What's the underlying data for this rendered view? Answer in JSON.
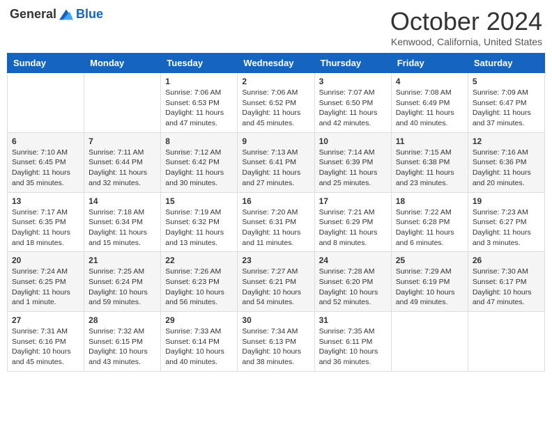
{
  "header": {
    "logo_general": "General",
    "logo_blue": "Blue",
    "month_title": "October 2024",
    "location": "Kenwood, California, United States"
  },
  "days_of_week": [
    "Sunday",
    "Monday",
    "Tuesday",
    "Wednesday",
    "Thursday",
    "Friday",
    "Saturday"
  ],
  "weeks": [
    [
      {
        "day": "",
        "info": ""
      },
      {
        "day": "",
        "info": ""
      },
      {
        "day": "1",
        "info": "Sunrise: 7:06 AM\nSunset: 6:53 PM\nDaylight: 11 hours and 47 minutes."
      },
      {
        "day": "2",
        "info": "Sunrise: 7:06 AM\nSunset: 6:52 PM\nDaylight: 11 hours and 45 minutes."
      },
      {
        "day": "3",
        "info": "Sunrise: 7:07 AM\nSunset: 6:50 PM\nDaylight: 11 hours and 42 minutes."
      },
      {
        "day": "4",
        "info": "Sunrise: 7:08 AM\nSunset: 6:49 PM\nDaylight: 11 hours and 40 minutes."
      },
      {
        "day": "5",
        "info": "Sunrise: 7:09 AM\nSunset: 6:47 PM\nDaylight: 11 hours and 37 minutes."
      }
    ],
    [
      {
        "day": "6",
        "info": "Sunrise: 7:10 AM\nSunset: 6:45 PM\nDaylight: 11 hours and 35 minutes."
      },
      {
        "day": "7",
        "info": "Sunrise: 7:11 AM\nSunset: 6:44 PM\nDaylight: 11 hours and 32 minutes."
      },
      {
        "day": "8",
        "info": "Sunrise: 7:12 AM\nSunset: 6:42 PM\nDaylight: 11 hours and 30 minutes."
      },
      {
        "day": "9",
        "info": "Sunrise: 7:13 AM\nSunset: 6:41 PM\nDaylight: 11 hours and 27 minutes."
      },
      {
        "day": "10",
        "info": "Sunrise: 7:14 AM\nSunset: 6:39 PM\nDaylight: 11 hours and 25 minutes."
      },
      {
        "day": "11",
        "info": "Sunrise: 7:15 AM\nSunset: 6:38 PM\nDaylight: 11 hours and 23 minutes."
      },
      {
        "day": "12",
        "info": "Sunrise: 7:16 AM\nSunset: 6:36 PM\nDaylight: 11 hours and 20 minutes."
      }
    ],
    [
      {
        "day": "13",
        "info": "Sunrise: 7:17 AM\nSunset: 6:35 PM\nDaylight: 11 hours and 18 minutes."
      },
      {
        "day": "14",
        "info": "Sunrise: 7:18 AM\nSunset: 6:34 PM\nDaylight: 11 hours and 15 minutes."
      },
      {
        "day": "15",
        "info": "Sunrise: 7:19 AM\nSunset: 6:32 PM\nDaylight: 11 hours and 13 minutes."
      },
      {
        "day": "16",
        "info": "Sunrise: 7:20 AM\nSunset: 6:31 PM\nDaylight: 11 hours and 11 minutes."
      },
      {
        "day": "17",
        "info": "Sunrise: 7:21 AM\nSunset: 6:29 PM\nDaylight: 11 hours and 8 minutes."
      },
      {
        "day": "18",
        "info": "Sunrise: 7:22 AM\nSunset: 6:28 PM\nDaylight: 11 hours and 6 minutes."
      },
      {
        "day": "19",
        "info": "Sunrise: 7:23 AM\nSunset: 6:27 PM\nDaylight: 11 hours and 3 minutes."
      }
    ],
    [
      {
        "day": "20",
        "info": "Sunrise: 7:24 AM\nSunset: 6:25 PM\nDaylight: 11 hours and 1 minute."
      },
      {
        "day": "21",
        "info": "Sunrise: 7:25 AM\nSunset: 6:24 PM\nDaylight: 10 hours and 59 minutes."
      },
      {
        "day": "22",
        "info": "Sunrise: 7:26 AM\nSunset: 6:23 PM\nDaylight: 10 hours and 56 minutes."
      },
      {
        "day": "23",
        "info": "Sunrise: 7:27 AM\nSunset: 6:21 PM\nDaylight: 10 hours and 54 minutes."
      },
      {
        "day": "24",
        "info": "Sunrise: 7:28 AM\nSunset: 6:20 PM\nDaylight: 10 hours and 52 minutes."
      },
      {
        "day": "25",
        "info": "Sunrise: 7:29 AM\nSunset: 6:19 PM\nDaylight: 10 hours and 49 minutes."
      },
      {
        "day": "26",
        "info": "Sunrise: 7:30 AM\nSunset: 6:17 PM\nDaylight: 10 hours and 47 minutes."
      }
    ],
    [
      {
        "day": "27",
        "info": "Sunrise: 7:31 AM\nSunset: 6:16 PM\nDaylight: 10 hours and 45 minutes."
      },
      {
        "day": "28",
        "info": "Sunrise: 7:32 AM\nSunset: 6:15 PM\nDaylight: 10 hours and 43 minutes."
      },
      {
        "day": "29",
        "info": "Sunrise: 7:33 AM\nSunset: 6:14 PM\nDaylight: 10 hours and 40 minutes."
      },
      {
        "day": "30",
        "info": "Sunrise: 7:34 AM\nSunset: 6:13 PM\nDaylight: 10 hours and 38 minutes."
      },
      {
        "day": "31",
        "info": "Sunrise: 7:35 AM\nSunset: 6:11 PM\nDaylight: 10 hours and 36 minutes."
      },
      {
        "day": "",
        "info": ""
      },
      {
        "day": "",
        "info": ""
      }
    ]
  ]
}
